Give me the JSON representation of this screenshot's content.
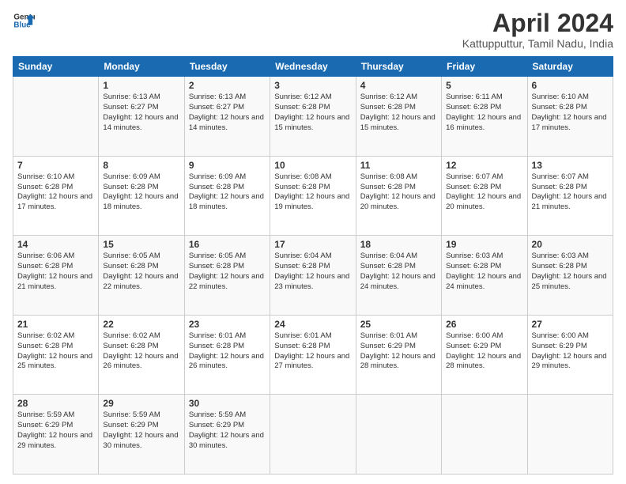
{
  "header": {
    "logo_line1": "General",
    "logo_line2": "Blue",
    "main_title": "April 2024",
    "subtitle": "Kattupputtur, Tamil Nadu, India"
  },
  "days_of_week": [
    "Sunday",
    "Monday",
    "Tuesday",
    "Wednesday",
    "Thursday",
    "Friday",
    "Saturday"
  ],
  "weeks": [
    [
      {
        "day": "",
        "info": ""
      },
      {
        "day": "1",
        "info": "Sunrise: 6:13 AM\nSunset: 6:27 PM\nDaylight: 12 hours\nand 14 minutes."
      },
      {
        "day": "2",
        "info": "Sunrise: 6:13 AM\nSunset: 6:27 PM\nDaylight: 12 hours\nand 14 minutes."
      },
      {
        "day": "3",
        "info": "Sunrise: 6:12 AM\nSunset: 6:28 PM\nDaylight: 12 hours\nand 15 minutes."
      },
      {
        "day": "4",
        "info": "Sunrise: 6:12 AM\nSunset: 6:28 PM\nDaylight: 12 hours\nand 15 minutes."
      },
      {
        "day": "5",
        "info": "Sunrise: 6:11 AM\nSunset: 6:28 PM\nDaylight: 12 hours\nand 16 minutes."
      },
      {
        "day": "6",
        "info": "Sunrise: 6:10 AM\nSunset: 6:28 PM\nDaylight: 12 hours\nand 17 minutes."
      }
    ],
    [
      {
        "day": "7",
        "info": "Sunrise: 6:10 AM\nSunset: 6:28 PM\nDaylight: 12 hours\nand 17 minutes."
      },
      {
        "day": "8",
        "info": "Sunrise: 6:09 AM\nSunset: 6:28 PM\nDaylight: 12 hours\nand 18 minutes."
      },
      {
        "day": "9",
        "info": "Sunrise: 6:09 AM\nSunset: 6:28 PM\nDaylight: 12 hours\nand 18 minutes."
      },
      {
        "day": "10",
        "info": "Sunrise: 6:08 AM\nSunset: 6:28 PM\nDaylight: 12 hours\nand 19 minutes."
      },
      {
        "day": "11",
        "info": "Sunrise: 6:08 AM\nSunset: 6:28 PM\nDaylight: 12 hours\nand 20 minutes."
      },
      {
        "day": "12",
        "info": "Sunrise: 6:07 AM\nSunset: 6:28 PM\nDaylight: 12 hours\nand 20 minutes."
      },
      {
        "day": "13",
        "info": "Sunrise: 6:07 AM\nSunset: 6:28 PM\nDaylight: 12 hours\nand 21 minutes."
      }
    ],
    [
      {
        "day": "14",
        "info": "Sunrise: 6:06 AM\nSunset: 6:28 PM\nDaylight: 12 hours\nand 21 minutes."
      },
      {
        "day": "15",
        "info": "Sunrise: 6:05 AM\nSunset: 6:28 PM\nDaylight: 12 hours\nand 22 minutes."
      },
      {
        "day": "16",
        "info": "Sunrise: 6:05 AM\nSunset: 6:28 PM\nDaylight: 12 hours\nand 22 minutes."
      },
      {
        "day": "17",
        "info": "Sunrise: 6:04 AM\nSunset: 6:28 PM\nDaylight: 12 hours\nand 23 minutes."
      },
      {
        "day": "18",
        "info": "Sunrise: 6:04 AM\nSunset: 6:28 PM\nDaylight: 12 hours\nand 24 minutes."
      },
      {
        "day": "19",
        "info": "Sunrise: 6:03 AM\nSunset: 6:28 PM\nDaylight: 12 hours\nand 24 minutes."
      },
      {
        "day": "20",
        "info": "Sunrise: 6:03 AM\nSunset: 6:28 PM\nDaylight: 12 hours\nand 25 minutes."
      }
    ],
    [
      {
        "day": "21",
        "info": "Sunrise: 6:02 AM\nSunset: 6:28 PM\nDaylight: 12 hours\nand 25 minutes."
      },
      {
        "day": "22",
        "info": "Sunrise: 6:02 AM\nSunset: 6:28 PM\nDaylight: 12 hours\nand 26 minutes."
      },
      {
        "day": "23",
        "info": "Sunrise: 6:01 AM\nSunset: 6:28 PM\nDaylight: 12 hours\nand 26 minutes."
      },
      {
        "day": "24",
        "info": "Sunrise: 6:01 AM\nSunset: 6:28 PM\nDaylight: 12 hours\nand 27 minutes."
      },
      {
        "day": "25",
        "info": "Sunrise: 6:01 AM\nSunset: 6:29 PM\nDaylight: 12 hours\nand 28 minutes."
      },
      {
        "day": "26",
        "info": "Sunrise: 6:00 AM\nSunset: 6:29 PM\nDaylight: 12 hours\nand 28 minutes."
      },
      {
        "day": "27",
        "info": "Sunrise: 6:00 AM\nSunset: 6:29 PM\nDaylight: 12 hours\nand 29 minutes."
      }
    ],
    [
      {
        "day": "28",
        "info": "Sunrise: 5:59 AM\nSunset: 6:29 PM\nDaylight: 12 hours\nand 29 minutes."
      },
      {
        "day": "29",
        "info": "Sunrise: 5:59 AM\nSunset: 6:29 PM\nDaylight: 12 hours\nand 30 minutes."
      },
      {
        "day": "30",
        "info": "Sunrise: 5:59 AM\nSunset: 6:29 PM\nDaylight: 12 hours\nand 30 minutes."
      },
      {
        "day": "",
        "info": ""
      },
      {
        "day": "",
        "info": ""
      },
      {
        "day": "",
        "info": ""
      },
      {
        "day": "",
        "info": ""
      }
    ]
  ]
}
